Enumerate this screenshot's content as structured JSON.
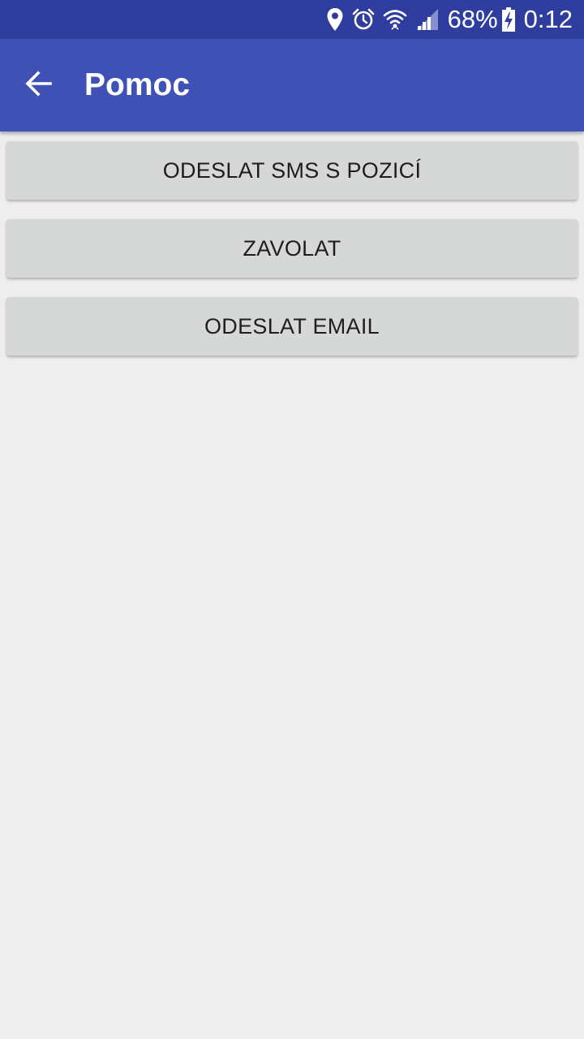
{
  "status_bar": {
    "battery_percent": "68%",
    "time": "0:12",
    "icons": [
      "location-icon",
      "alarm-icon",
      "wifi-icon",
      "signal-icon",
      "battery-charging-icon"
    ]
  },
  "app_bar": {
    "title": "Pomoc",
    "back_icon": "arrow-back-icon"
  },
  "buttons": [
    {
      "label": "ODESLAT SMS S POZICÍ"
    },
    {
      "label": "ZAVOLAT"
    },
    {
      "label": "ODESLAT EMAIL"
    }
  ],
  "colors": {
    "status_bar": "#2f3e9e",
    "app_bar": "#3f51b5",
    "background": "#eeeeee",
    "button": "#d6d7d7"
  }
}
